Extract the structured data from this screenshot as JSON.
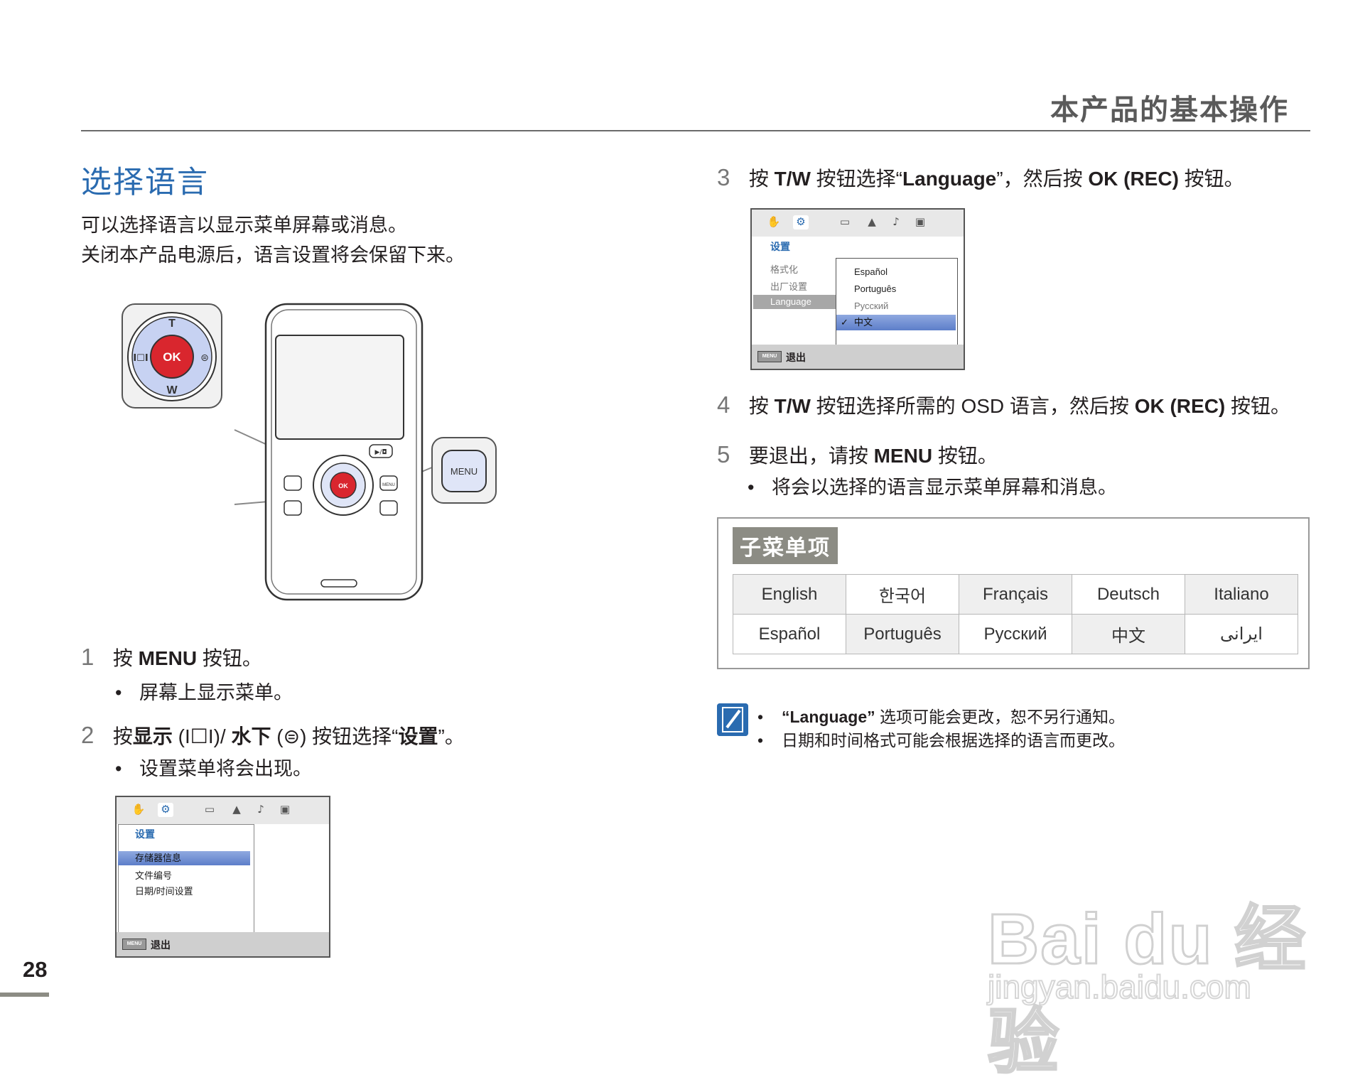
{
  "header": {
    "title": "本产品的基本操作"
  },
  "section": {
    "title": "选择语言",
    "intro": [
      "可以选择语言以显示菜单屏幕或消息。",
      "关闭本产品电源后，语言设置将会保留下来。"
    ]
  },
  "camera": {
    "ok": "OK",
    "t": "T",
    "w": "W",
    "menu": "MENU"
  },
  "steps": {
    "s1": {
      "num": "1",
      "pre": "按 ",
      "bold": "MENU",
      "post": " 按钮。",
      "bullet": "屏幕上显示菜单。"
    },
    "s2": {
      "num": "2",
      "a": "按",
      "b": "显示",
      "c": " (I☐I)/ ",
      "d": "水下",
      "e": " (⊜) 按钮选择“",
      "f": "设置",
      "g": "”。",
      "bullet": "设置菜单将会出现。"
    },
    "s3": {
      "num": "3",
      "a": "按 ",
      "b": "T/W",
      "c": " 按钮选择“",
      "d": "Language",
      "e": "”，然后按 ",
      "f": "OK (REC)",
      "g": " 按钮。"
    },
    "s4": {
      "num": "4",
      "a": "按 ",
      "b": "T/W",
      "c": " 按钮选择所需的 OSD 语言，然后按 ",
      "d": "OK (REC)",
      "e": " 按钮。"
    },
    "s5": {
      "num": "5",
      "a": "要退出，请按 ",
      "b": "MENU",
      "c": " 按钮。",
      "bullet": "将会以选择的语言显示菜单屏幕和消息。"
    }
  },
  "menu1": {
    "tab": "设置",
    "items": [
      "存储器信息",
      "文件编号",
      "日期/时间设置"
    ],
    "selected": 0,
    "footer_btn": "MENU",
    "footer": "退出"
  },
  "menu2": {
    "tab": "设置",
    "items": [
      "格式化",
      "出厂设置",
      "Language"
    ],
    "options": [
      "Español",
      "Português",
      "Русский",
      "中文"
    ],
    "selected_option": 3,
    "footer_btn": "MENU",
    "footer": "退出"
  },
  "submenu": {
    "label": "子菜单项",
    "rows": [
      [
        "English",
        "한국어",
        "Français",
        "Deutsch",
        "Italiano"
      ],
      [
        "Español",
        "Português",
        "Русский",
        "中文",
        "ایرانی"
      ]
    ]
  },
  "notes": [
    {
      "bold": "“Language”",
      "text": " 选项可能会更改，恕不另行通知。"
    },
    {
      "bold": "",
      "text": "日期和时间格式可能会根据选择的语言而更改。"
    }
  ],
  "page_number": "28",
  "watermark": {
    "main": "Bai du 经验",
    "sub": "jingyan.baidu.com"
  },
  "colors": {
    "title_blue": "#2a6bb0",
    "ok_red": "#d9262e",
    "dial_blue": "#c7d2f2",
    "selection_blue": "#6b8bd3"
  }
}
